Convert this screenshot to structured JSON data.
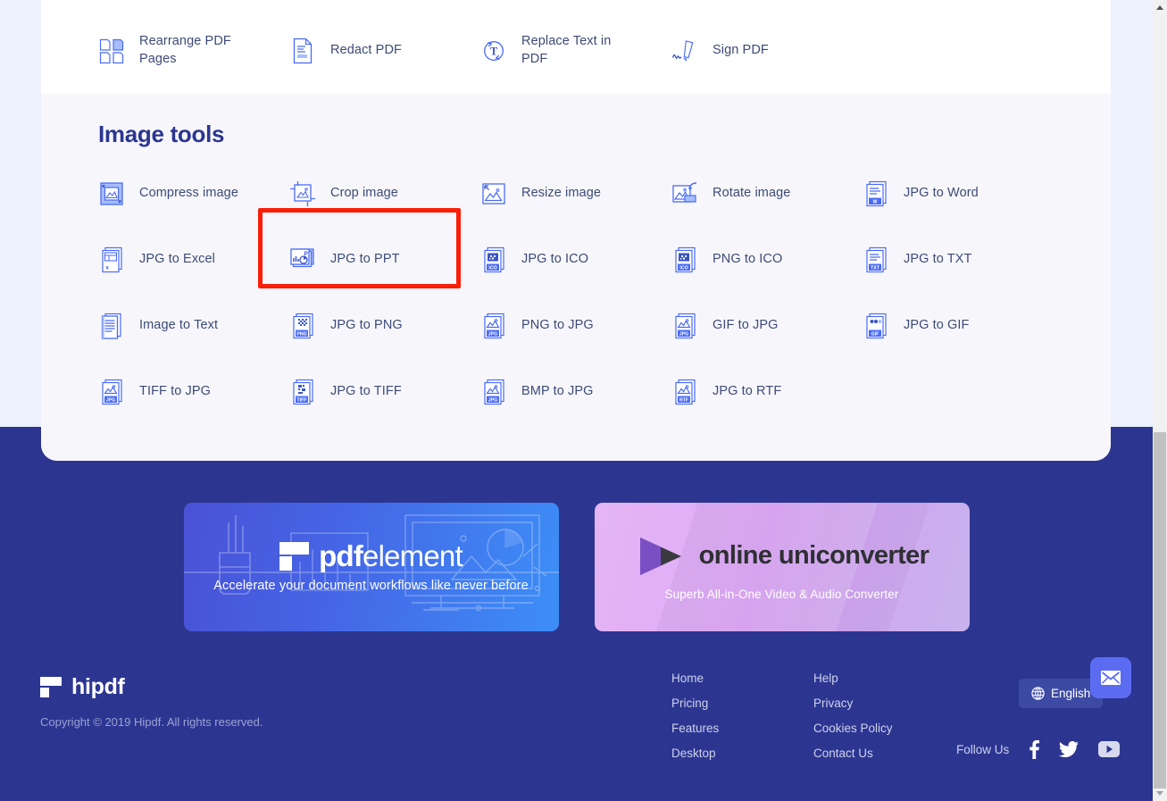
{
  "page": {
    "background_color": "#edf0fd",
    "card_color": "#ffffff",
    "section_bg_color": "#f7f7fb",
    "footer_color": "#2c3691",
    "accent_color": "#5c6cf2",
    "highlight_color": "#fb1e08",
    "label_color": "#3d4a78"
  },
  "pdf_tools": {
    "items": [
      {
        "label": "Rearrange PDF Pages",
        "icon": "rearrange-pdf-pages-icon"
      },
      {
        "label": "Redact PDF",
        "icon": "redact-pdf-icon"
      },
      {
        "label": "Replace Text in PDF",
        "icon": "replace-text-in-pdf-icon"
      },
      {
        "label": "Sign PDF",
        "icon": "sign-pdf-icon"
      }
    ]
  },
  "image_tools": {
    "title": "Image tools",
    "items": [
      {
        "label": "Compress image",
        "icon": "compress-image-icon"
      },
      {
        "label": "Crop image",
        "icon": "crop-image-icon"
      },
      {
        "label": "Resize image",
        "icon": "resize-image-icon"
      },
      {
        "label": "Rotate image",
        "icon": "rotate-image-icon"
      },
      {
        "label": "JPG to Word",
        "icon": "jpg-to-word-icon"
      },
      {
        "label": "JPG to Excel",
        "icon": "jpg-to-excel-icon"
      },
      {
        "label": "JPG to PPT",
        "icon": "jpg-to-ppt-icon"
      },
      {
        "label": "JPG to ICO",
        "icon": "jpg-to-ico-icon"
      },
      {
        "label": "PNG to ICO",
        "icon": "png-to-ico-icon"
      },
      {
        "label": "JPG to TXT",
        "icon": "jpg-to-txt-icon"
      },
      {
        "label": "Image to Text",
        "icon": "image-to-text-icon"
      },
      {
        "label": "JPG to PNG",
        "icon": "jpg-to-png-icon"
      },
      {
        "label": "PNG to JPG",
        "icon": "png-to-jpg-icon"
      },
      {
        "label": "GIF to JPG",
        "icon": "gif-to-jpg-icon"
      },
      {
        "label": "JPG to GIF",
        "icon": "jpg-to-gif-icon"
      },
      {
        "label": "TIFF to JPG",
        "icon": "tiff-to-jpg-icon"
      },
      {
        "label": "JPG to TIFF",
        "icon": "jpg-to-tiff-icon"
      },
      {
        "label": "BMP to JPG",
        "icon": "bmp-to-jpg-icon"
      },
      {
        "label": "JPG to RTF",
        "icon": "jpg-to-rtf-icon"
      }
    ],
    "highlighted_item": "JPG to PPT"
  },
  "banners": [
    {
      "brand_bold": "pdf",
      "brand_light": "element",
      "tagline": "Accelerate your document workflows like never before"
    },
    {
      "brand": "online uniconverter",
      "tagline": "Superb All-in-One Video & Audio Converter"
    }
  ],
  "footer": {
    "brand": "hipdf",
    "copyright": "Copyright © 2019 Hipdf. All rights reserved.",
    "links_col1": [
      "Home",
      "Pricing",
      "Features",
      "Desktop"
    ],
    "links_col2": [
      "Help",
      "Privacy",
      "Cookies Policy",
      "Contact Us"
    ],
    "follow_label": "Follow Us",
    "social": [
      "facebook-icon",
      "twitter-icon",
      "youtube-icon"
    ],
    "language": "English",
    "mail_button": "mail-icon"
  }
}
